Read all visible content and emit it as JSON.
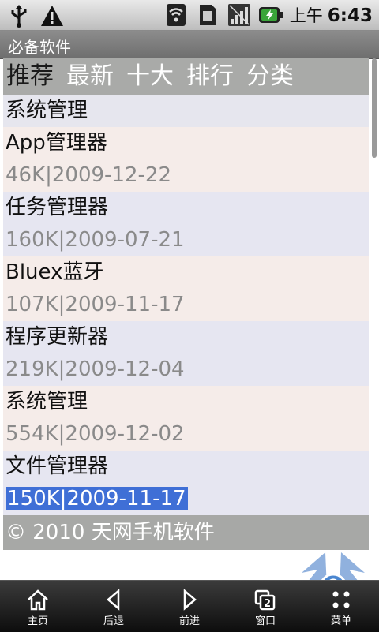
{
  "status_bar": {
    "ampm": "上午",
    "time": "6:43",
    "icons": [
      "usb-icon",
      "warning-icon",
      "wifi-icon",
      "sim-icon",
      "signal-icon",
      "battery-charging-icon"
    ]
  },
  "app": {
    "title": "必备软件"
  },
  "tabs": [
    {
      "label": "推荐",
      "active": true
    },
    {
      "label": "最新",
      "active": false
    },
    {
      "label": "十大",
      "active": false
    },
    {
      "label": "排行",
      "active": false
    },
    {
      "label": "分类",
      "active": false
    }
  ],
  "section_title": "系统管理",
  "items": [
    {
      "name": "App管理器",
      "meta": "46K|2009-12-22"
    },
    {
      "name": "任务管理器",
      "meta": "160K|2009-07-21"
    },
    {
      "name": "Bluex蓝牙",
      "meta": "107K|2009-11-17"
    },
    {
      "name": "程序更新器",
      "meta": "219K|2009-12-04"
    },
    {
      "name": "系统管理",
      "meta": "554K|2009-12-02"
    },
    {
      "name": "文件管理器",
      "meta": "150K|2009-11-17",
      "selected": true
    }
  ],
  "footer": "© 2010 天网手机软件",
  "toolbar": {
    "home": "主页",
    "back": "后退",
    "forward": "前进",
    "windows": "窗口",
    "windows_count": "2",
    "menu": "菜单"
  },
  "colors": {
    "selection": "#3f6fd6",
    "tabs_bg": "#a9aaa8",
    "toolbar_bg": "#1a1a1a"
  }
}
